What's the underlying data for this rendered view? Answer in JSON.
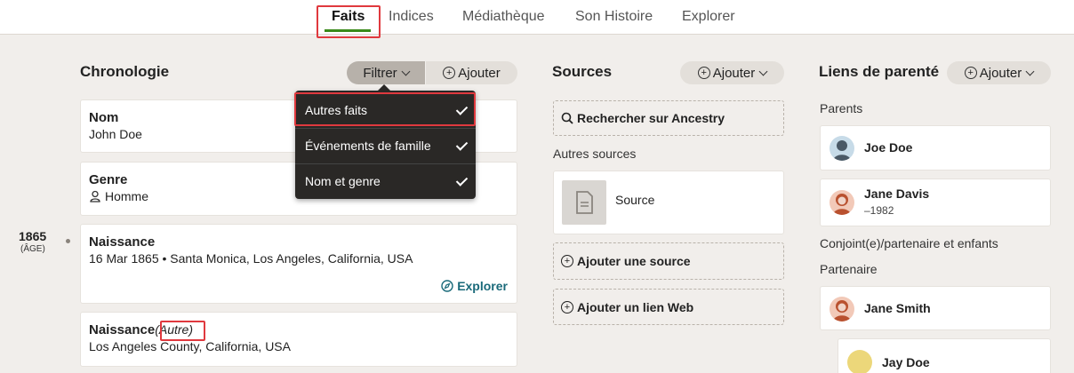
{
  "tabs": {
    "faits": "Faits",
    "indices": "Indices",
    "mediatheque": "Médiathèque",
    "histoire": "Son Histoire",
    "explorer": "Explorer"
  },
  "chronologie": {
    "heading": "Chronologie",
    "filter_label": "Filtrer",
    "add_label": "Ajouter",
    "year": "1865",
    "age": "(ÂGE)",
    "cards": {
      "nom": {
        "title": "Nom",
        "value": "John Doe"
      },
      "genre": {
        "title": "Genre",
        "value": "Homme"
      },
      "naissance": {
        "title": "Naissance",
        "value": "16 Mar 1865 • Santa Monica, Los Angeles, California, USA",
        "explore": "Explorer"
      },
      "naissance2": {
        "title": "Naissance",
        "tag": "(Autre)",
        "value": "Los Angeles County, California, USA"
      }
    }
  },
  "filter_menu": {
    "items": [
      "Autres faits",
      "Événements de famille",
      "Nom et genre"
    ]
  },
  "sources": {
    "heading": "Sources",
    "add_label": "Ajouter",
    "search": "Rechercher sur Ancestry",
    "other_label": "Autres sources",
    "source_item": "Source",
    "add_source": "Ajouter une source",
    "add_web": "Ajouter un lien Web"
  },
  "liens": {
    "heading": "Liens de parenté",
    "add_label": "Ajouter",
    "parents_label": "Parents",
    "parents": [
      {
        "name": "Joe Doe",
        "dates": ""
      },
      {
        "name": "Jane Davis",
        "dates": "–1982"
      }
    ],
    "spouse_section": "Conjoint(e)/partenaire et enfants",
    "partner_label": "Partenaire",
    "partner": {
      "name": "Jane Smith"
    },
    "child": {
      "name": "Jay Doe"
    }
  },
  "colors": {
    "accent_green": "#3a8a1a",
    "highlight_red": "#e0393e",
    "link_teal": "#1a6a7a",
    "menu_bg": "#2a2826"
  }
}
